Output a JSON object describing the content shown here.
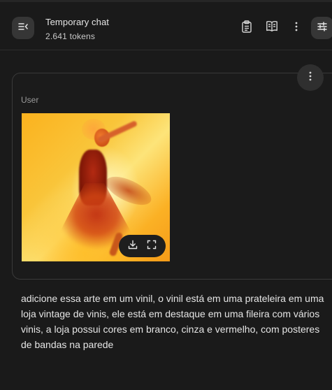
{
  "header": {
    "title": "Temporary chat",
    "subtitle": "2.641 tokens",
    "icons": {
      "menu": "sidebar-collapse-icon",
      "clipboard": "clipboard-icon",
      "book": "book-icon",
      "more": "more-vertical-icon",
      "tune": "tune-icon"
    }
  },
  "message": {
    "role": "User",
    "text": "adicione essa arte em um vinil, o vinil está em uma prateleira em uma loja vintage de vinis, ele está em destaque em uma fileira com vários vinis, a loja possui cores em branco, cinza e vermelho, com posteres de bandas na parede",
    "image_actions": [
      "download-icon",
      "fullscreen-icon"
    ]
  },
  "colors": {
    "background": "#1a1a1a",
    "card_border": "#3a3a3a",
    "button_bg": "#363636"
  }
}
